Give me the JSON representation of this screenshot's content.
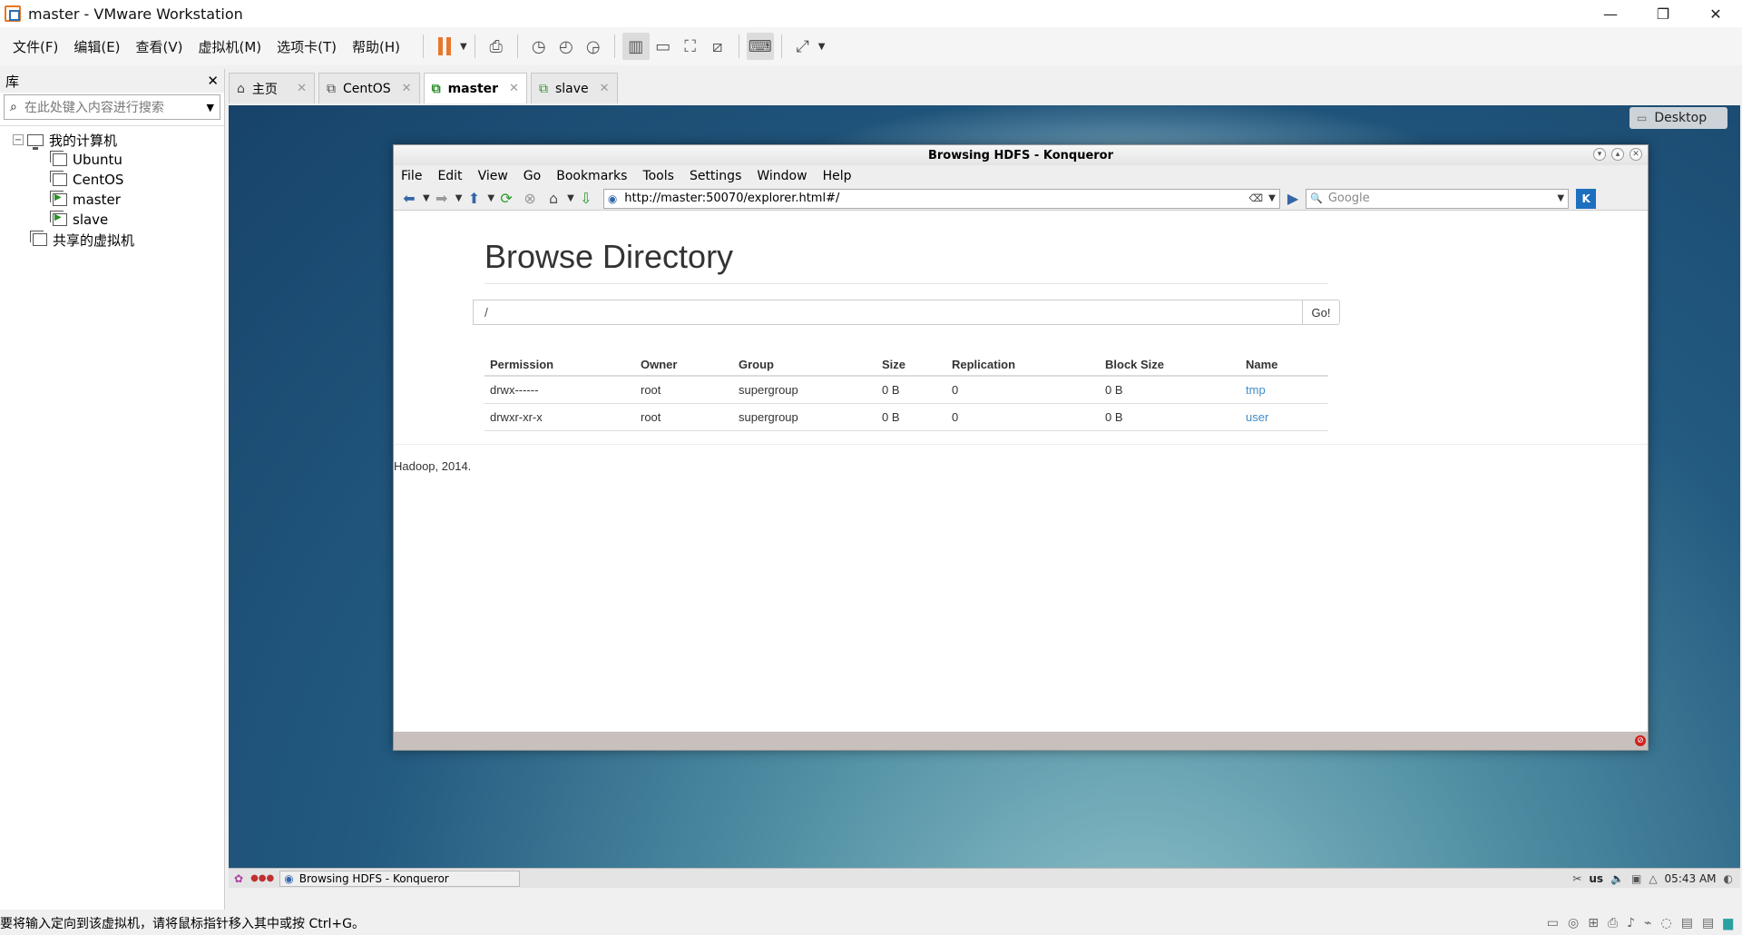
{
  "window": {
    "title": "master - VMware Workstation"
  },
  "menu": [
    "文件(F)",
    "编辑(E)",
    "查看(V)",
    "虚拟机(M)",
    "选项卡(T)",
    "帮助(H)"
  ],
  "library": {
    "title": "库",
    "search_placeholder": "在此处键入内容进行搜索",
    "root": "我的计算机",
    "vms": [
      "Ubuntu",
      "CentOS",
      "master",
      "slave"
    ],
    "shared": "共享的虚拟机"
  },
  "tabs": [
    {
      "label": "主页",
      "icon": "home-icon"
    },
    {
      "label": "CentOS",
      "icon": "vm-icon"
    },
    {
      "label": "master",
      "icon": "vm-running-icon",
      "active": true
    },
    {
      "label": "slave",
      "icon": "vm-running-icon"
    }
  ],
  "guest": {
    "desktop_button": "Desktop",
    "konqueror": {
      "title": "Browsing HDFS - Konqueror",
      "menu": [
        "File",
        "Edit",
        "View",
        "Go",
        "Bookmarks",
        "Tools",
        "Settings",
        "Window",
        "Help"
      ],
      "url": "http://master:50070/explorer.html#/",
      "search_placeholder": "Google",
      "page": {
        "heading": "Browse Directory",
        "path": "/",
        "go_label": "Go!",
        "columns": [
          "Permission",
          "Owner",
          "Group",
          "Size",
          "Replication",
          "Block Size",
          "Name"
        ],
        "rows": [
          [
            "drwx------",
            "root",
            "supergroup",
            "0 B",
            "0",
            "0 B",
            "tmp"
          ],
          [
            "drwxr-xr-x",
            "root",
            "supergroup",
            "0 B",
            "0",
            "0 B",
            "user"
          ]
        ],
        "footer": "Hadoop, 2014."
      }
    },
    "panel": {
      "task": "Browsing HDFS - Konqueror",
      "keyboard": "us",
      "clock": "05:43 AM"
    }
  },
  "status_message": "要将输入定向到该虚拟机，请将鼠标指针移入其中或按 Ctrl+G。",
  "colors": {
    "link": "#428bca",
    "pause": "#e8772e"
  }
}
